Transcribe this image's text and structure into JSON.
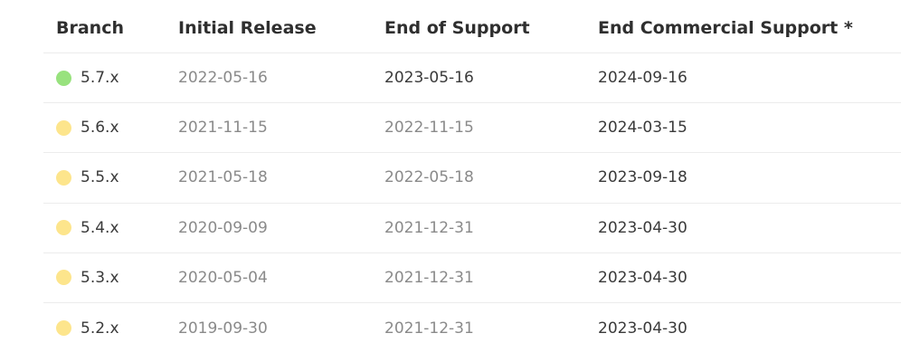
{
  "header": {
    "branch": "Branch",
    "initial_release": "Initial Release",
    "end_of_support": "End of Support",
    "end_commercial_support": "End Commercial Support *"
  },
  "colors": {
    "active": "#98e27e",
    "security": "#fde58c",
    "muted_text": "#8a8a8a",
    "strong_text": "#3a3a3a"
  },
  "rows": [
    {
      "branch": "5.7.x",
      "status": "active",
      "initial": "2022-05-16",
      "eos": "2023-05-16",
      "ecs": "2024-09-16"
    },
    {
      "branch": "5.6.x",
      "status": "security",
      "initial": "2021-11-15",
      "eos": "2022-11-15",
      "ecs": "2024-03-15"
    },
    {
      "branch": "5.5.x",
      "status": "security",
      "initial": "2021-05-18",
      "eos": "2022-05-18",
      "ecs": "2023-09-18"
    },
    {
      "branch": "5.4.x",
      "status": "security",
      "initial": "2020-09-09",
      "eos": "2021-12-31",
      "ecs": "2023-04-30"
    },
    {
      "branch": "5.3.x",
      "status": "security",
      "initial": "2020-05-04",
      "eos": "2021-12-31",
      "ecs": "2023-04-30"
    },
    {
      "branch": "5.2.x",
      "status": "security",
      "initial": "2019-09-30",
      "eos": "2021-12-31",
      "ecs": "2023-04-30"
    }
  ]
}
